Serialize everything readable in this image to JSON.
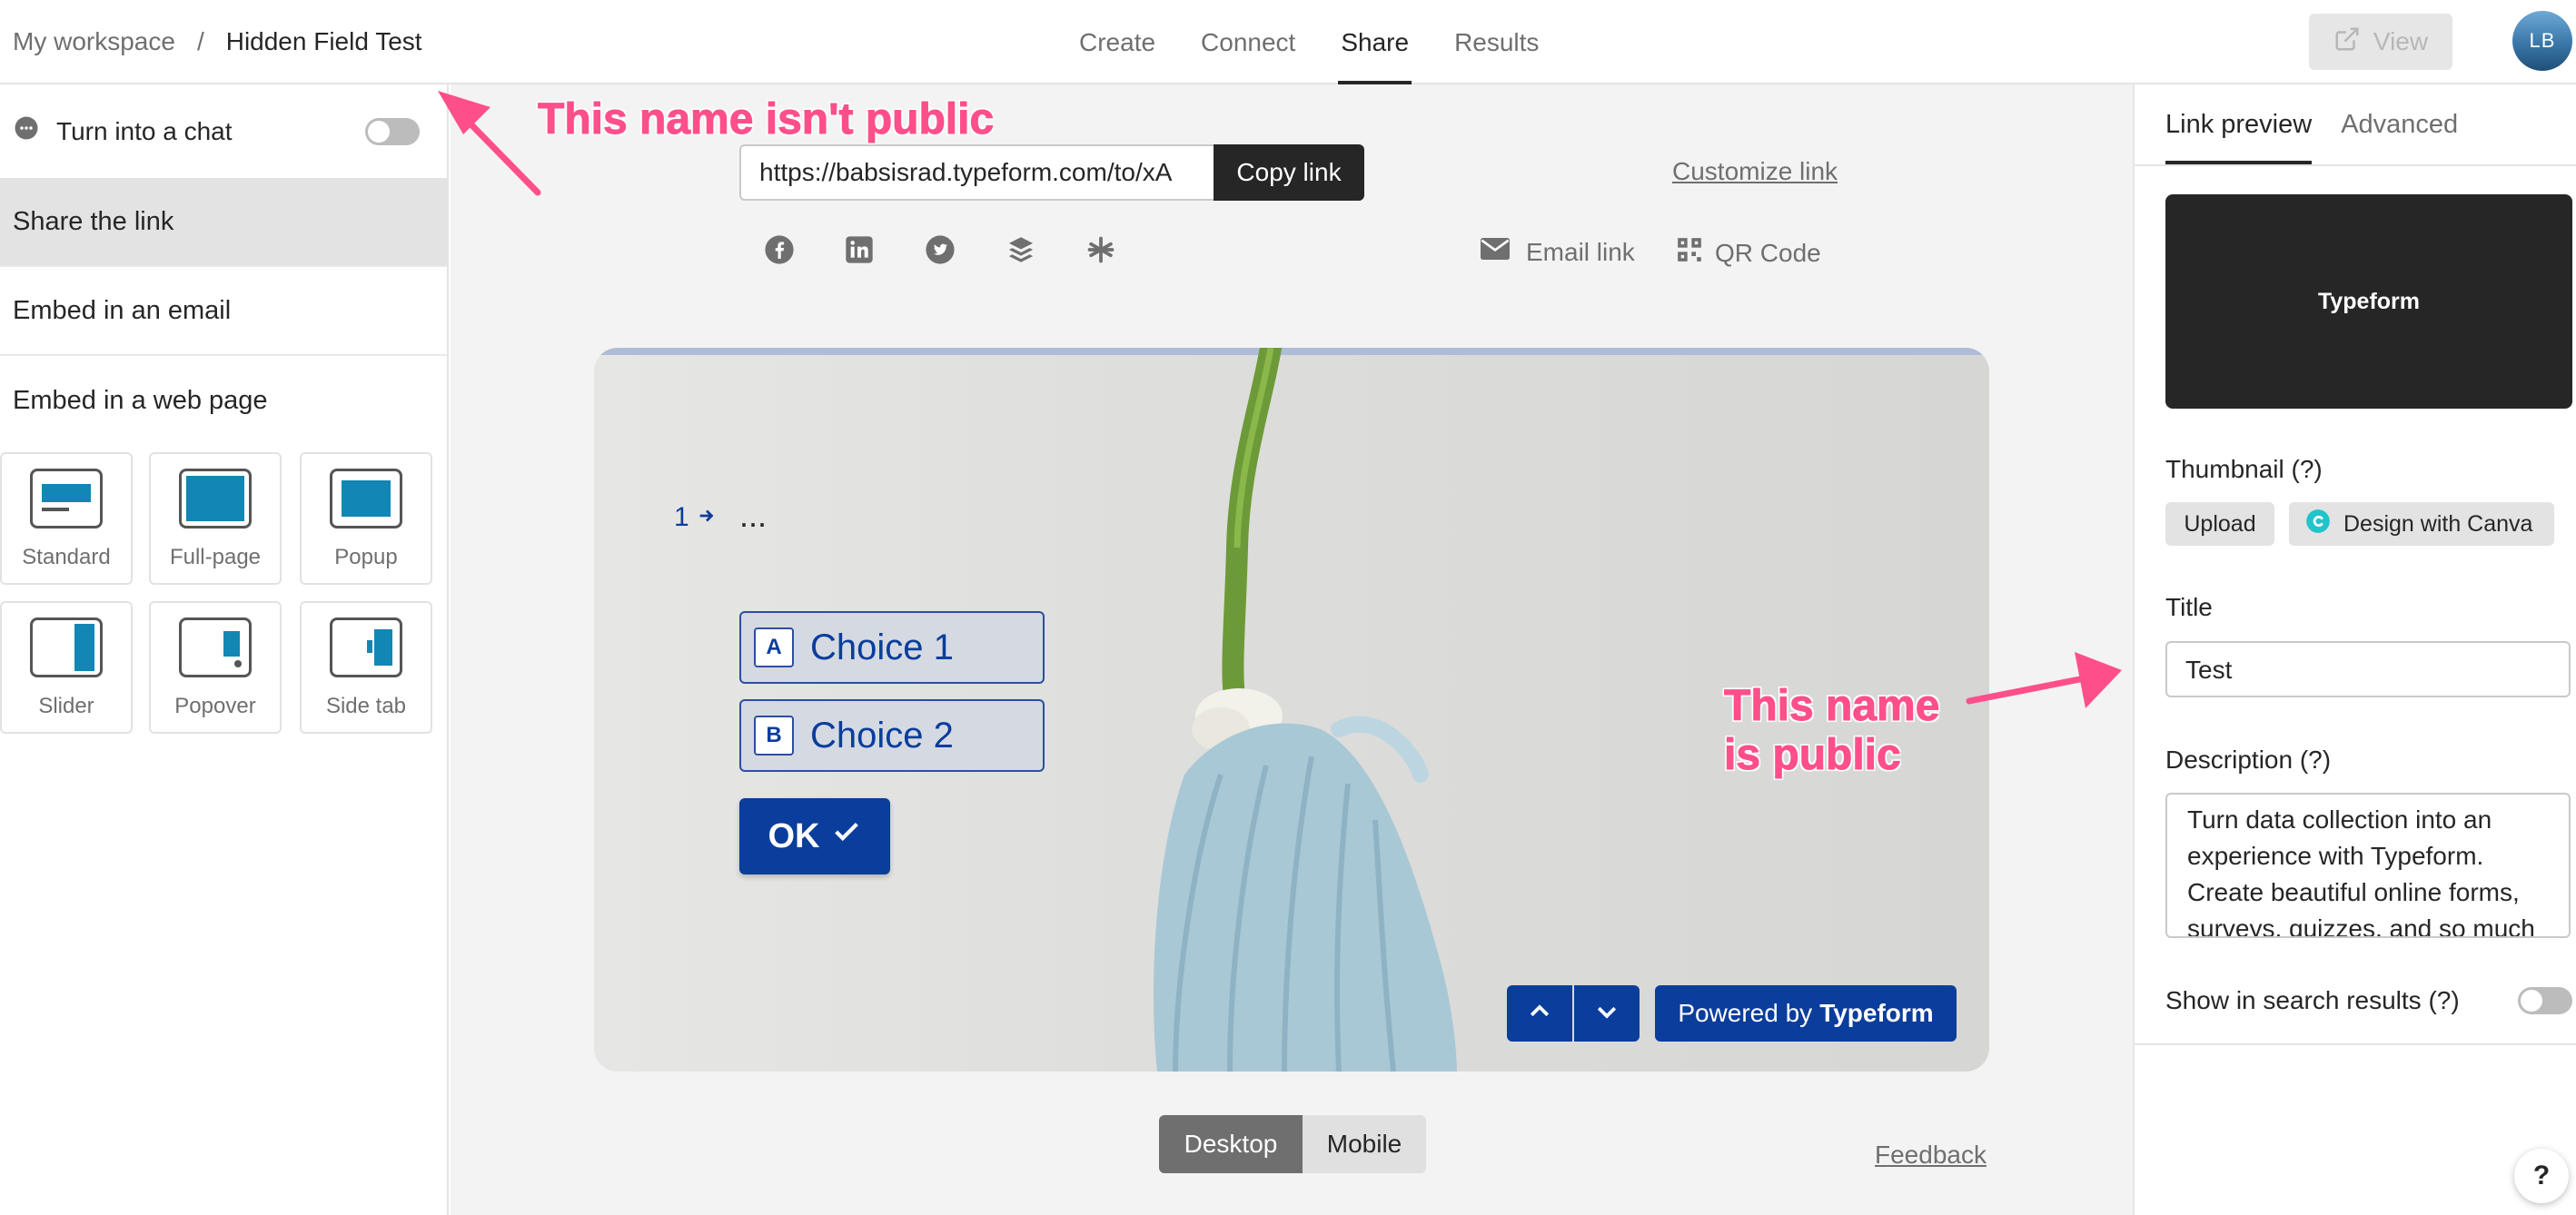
{
  "breadcrumb": {
    "workspace": "My workspace",
    "separator": "/",
    "form_name": "Hidden Field Test"
  },
  "nav": {
    "tabs": [
      {
        "label": "Create"
      },
      {
        "label": "Connect"
      },
      {
        "label": "Share",
        "active": true
      },
      {
        "label": "Results"
      }
    ]
  },
  "header": {
    "view_label": "View",
    "avatar_initials": "LB"
  },
  "sidebar": {
    "chat_label": "Turn into a chat",
    "chat_toggle_on": false,
    "items": [
      {
        "label": "Share the link",
        "active": true
      },
      {
        "label": "Embed in an email"
      },
      {
        "label": "Embed in a web page"
      }
    ],
    "embed_options": [
      {
        "label": "Standard"
      },
      {
        "label": "Full-page"
      },
      {
        "label": "Popup"
      },
      {
        "label": "Slider"
      },
      {
        "label": "Popover"
      },
      {
        "label": "Side tab"
      }
    ]
  },
  "share": {
    "link_url": "https://babsisrad.typeform.com/to/xA",
    "copy_label": "Copy link",
    "customize_label": "Customize link",
    "social_icons": [
      "facebook-icon",
      "linkedin-icon",
      "twitter-icon",
      "buffer-icon",
      "asterisk-icon"
    ],
    "email_label": "Email link",
    "qr_label": "QR Code"
  },
  "preview": {
    "question_number": "1",
    "question_text": "...",
    "choices": [
      {
        "key": "A",
        "label": "Choice 1"
      },
      {
        "key": "B",
        "label": "Choice 2"
      }
    ],
    "ok_label": "OK",
    "powered_prefix": "Powered by",
    "powered_brand": "Typeform",
    "device_options": [
      {
        "label": "Desktop",
        "active": true
      },
      {
        "label": "Mobile"
      }
    ],
    "feedback_label": "Feedback"
  },
  "right_panel": {
    "tabs": [
      {
        "label": "Link preview",
        "active": true
      },
      {
        "label": "Advanced"
      }
    ],
    "card_brand": "Typeform",
    "thumbnail_label": "Thumbnail (?)",
    "upload_label": "Upload",
    "canva_label": "Design with Canva",
    "title_label": "Title",
    "title_value": "Test",
    "description_label": "Description (?)",
    "description_value": "Turn data collection into an experience with Typeform. Create beautiful online forms, surveys, quizzes, and so much more.",
    "search_label": "Show in search results (?)",
    "search_toggle_on": false
  },
  "help_label": "?",
  "annotations": {
    "not_public": "This name isn't public",
    "is_public_line1": "This name",
    "is_public_line2": "is public"
  },
  "colors": {
    "accent": "#0a3d9c",
    "annotation": "#ff4f8b",
    "dark": "#262627"
  }
}
